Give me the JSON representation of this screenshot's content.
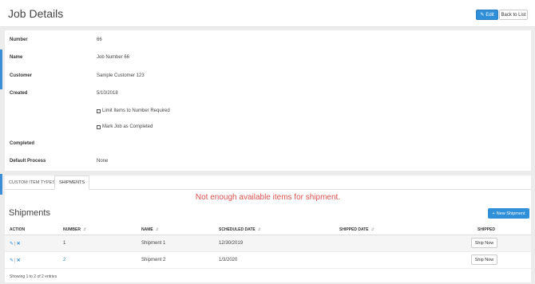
{
  "header": {
    "title": "Job Details",
    "edit_label": "Edit",
    "back_label": "Back to List"
  },
  "details": {
    "number_label": "Number",
    "number_value": "66",
    "name_label": "Name",
    "name_value": "Job Number 66",
    "customer_label": "Customer",
    "customer_value": "Sample Customer 123",
    "created_label": "Created",
    "created_value": "5/10/2018",
    "limit_items_label": "Limit Items to Number Required",
    "mark_completed_label": "Mark Job as Completed",
    "completed_label": "Completed",
    "default_process_label": "Default Process",
    "default_process_value": "None"
  },
  "tabs": [
    {
      "label": "CUSTOM ITEM TYPES",
      "active": false
    },
    {
      "label": "SHIPMENTS",
      "active": true
    }
  ],
  "alert": "Not enough available items for shipment.",
  "shipments": {
    "title": "Shipments",
    "new_button": "New Shipment",
    "columns": [
      "ACTION",
      "NUMBER",
      "NAME",
      "SCHEDULED DATE",
      "SHIPPED DATE",
      "SHIPPED"
    ],
    "rows": [
      {
        "number": "1",
        "name": "Shipment 1",
        "scheduled": "12/30/2019",
        "shipped_date": "",
        "ship_label": "Ship Now"
      },
      {
        "number": "2",
        "name": "Shipment 2",
        "scheduled": "1/3/2020",
        "shipped_date": "",
        "ship_label": "Ship Now"
      }
    ],
    "footer": "Showing 1 to 2 of 2 entries"
  },
  "colors": {
    "accent": "#2f8fd8",
    "alert": "#d9534f"
  },
  "icons": [
    "pencil-icon",
    "plus-icon",
    "delete-icon",
    "sort-icon"
  ]
}
